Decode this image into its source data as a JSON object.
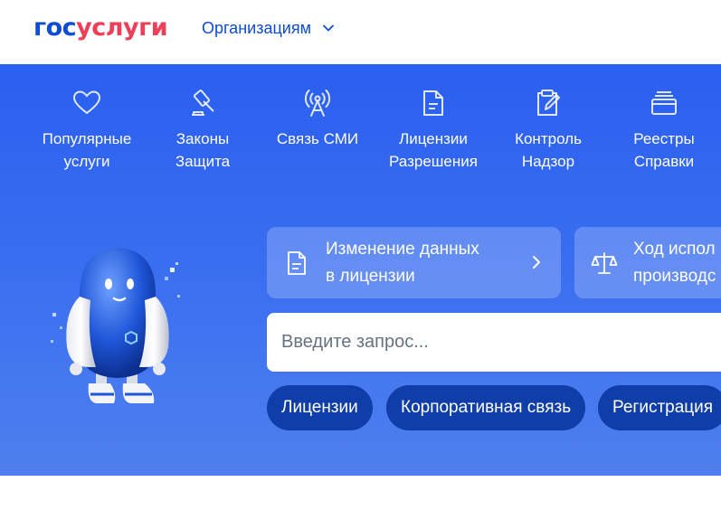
{
  "header": {
    "logo_part1": "гос",
    "logo_part2": "услуги",
    "org_menu_label": "Организациям"
  },
  "categories": [
    {
      "line1": "Популярные",
      "line2": "услуги",
      "icon": "heart-icon"
    },
    {
      "line1": "Законы",
      "line2": "Защита",
      "icon": "gavel-icon"
    },
    {
      "line1": "Связь СМИ",
      "line2": "",
      "icon": "antenna-icon"
    },
    {
      "line1": "Лицензии",
      "line2": "Разрешения",
      "icon": "document-icon"
    },
    {
      "line1": "Контроль",
      "line2": "Надзор",
      "icon": "clipboard-icon"
    },
    {
      "line1": "Реестры",
      "line2": "Справки",
      "icon": "folder-icon"
    }
  ],
  "quick_cards": [
    {
      "line1": "Изменение данных",
      "line2": "в лицензии",
      "icon": "document-icon"
    },
    {
      "line1": "Ход испол",
      "line2": "производс",
      "icon": "scales-icon"
    }
  ],
  "search": {
    "placeholder": "Введите запрос..."
  },
  "chips": [
    "Лицензии",
    "Корпоративная связь",
    "Регистрация"
  ],
  "colors": {
    "brand_blue": "#0d4cd3",
    "brand_red": "#ee3f58",
    "hero_bg": "#2f63ef",
    "chip_bg": "#0f3ea8"
  }
}
